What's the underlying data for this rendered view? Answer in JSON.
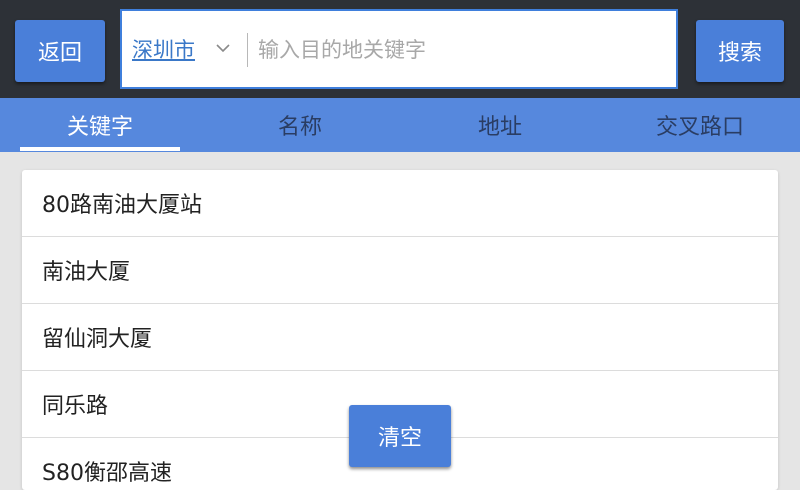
{
  "header": {
    "back_label": "返回",
    "city": "深圳市",
    "search_placeholder": "输入目的地关键字",
    "search_value": "",
    "search_button_label": "搜索"
  },
  "tabs": [
    {
      "label": "关键字",
      "active": true
    },
    {
      "label": "名称",
      "active": false
    },
    {
      "label": "地址",
      "active": false
    },
    {
      "label": "交叉路口",
      "active": false
    }
  ],
  "history": [
    {
      "label": "80路南油大厦站"
    },
    {
      "label": "南油大厦"
    },
    {
      "label": "留仙洞大厦"
    },
    {
      "label": "同乐路"
    },
    {
      "label": "S80衡邵高速"
    }
  ],
  "clear_button_label": "清空",
  "colors": {
    "topbar": "#2d3137",
    "accent": "#4a7fd9",
    "tab_bar": "#5688dd",
    "background": "#e5e5e5"
  }
}
